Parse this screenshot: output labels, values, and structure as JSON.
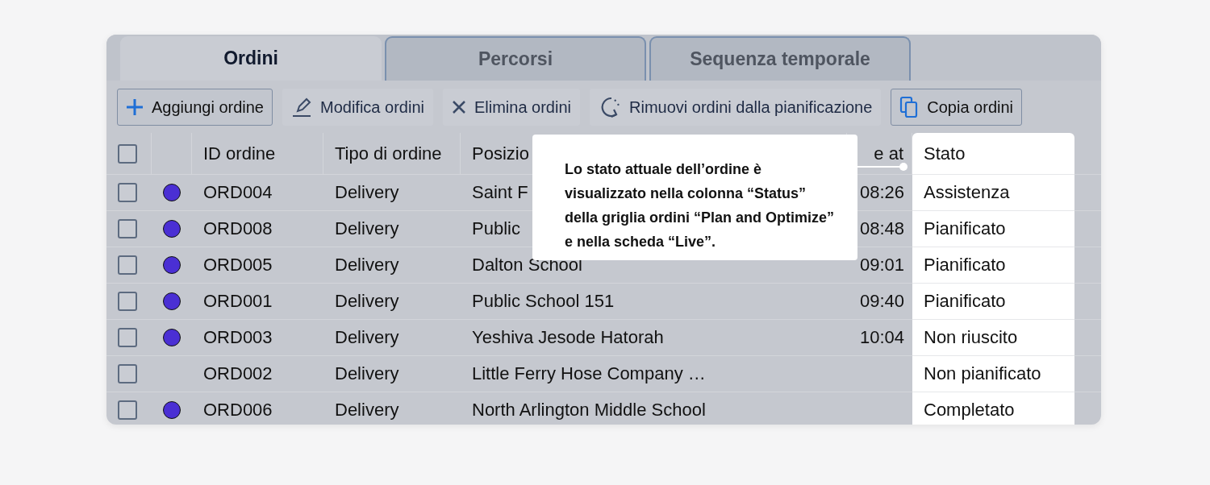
{
  "tabs": [
    {
      "label": "Ordini",
      "selected": true
    },
    {
      "label": "Percorsi",
      "selected": false
    },
    {
      "label": "Sequenza temporale",
      "selected": false
    }
  ],
  "toolbar": [
    {
      "label": "Aggiungi ordine",
      "kind": "add",
      "bordered": true
    },
    {
      "label": "Modifica ordini",
      "kind": "edit",
      "bordered": false
    },
    {
      "label": "Elimina ordini",
      "kind": "delete",
      "bordered": false
    },
    {
      "label": "Rimuovi ordini dalla pianificazione",
      "kind": "unplan",
      "bordered": false
    },
    {
      "label": "Copia ordini",
      "kind": "copy",
      "bordered": true
    }
  ],
  "table": {
    "select_all": {
      "checked": false
    },
    "columns": [
      {
        "label": "ID ordine",
        "highlighted": false
      },
      {
        "label": "Tipo di ordine",
        "highlighted": false
      },
      {
        "label": "Posizio",
        "highlighted": false
      },
      {
        "label": "e at",
        "highlighted": false
      },
      {
        "label": "Stato",
        "highlighted": true
      }
    ],
    "rows": [
      {
        "checked": false,
        "color": "#4a2fd4",
        "id": "ORD004",
        "type": "Delivery",
        "position": "Saint F",
        "column_6": "08:26",
        "status": "Assistenza"
      },
      {
        "checked": false,
        "color": "#4a2fd4",
        "id": "ORD008",
        "type": "Delivery",
        "position": "Public",
        "column_6": "08:48",
        "status": "Pianificato"
      },
      {
        "checked": false,
        "color": "#4a2fd4",
        "id": "ORD005",
        "type": "Delivery",
        "position": "Dalton School",
        "column_6": "09:01",
        "status": "Pianificato"
      },
      {
        "checked": false,
        "color": "#4a2fd4",
        "id": "ORD001",
        "type": "Delivery",
        "position": "Public School 151",
        "column_6": "09:40",
        "status": "Pianificato"
      },
      {
        "checked": false,
        "color": "#4a2fd4",
        "id": "ORD003",
        "type": "Delivery",
        "position": "Yeshiva Jesode Hatorah",
        "column_6": "10:04",
        "status": "Non riuscito"
      },
      {
        "checked": false,
        "id": "ORD002",
        "type": "Delivery",
        "position": "Little Ferry Hose Company …",
        "status": "Non pianificato"
      },
      {
        "checked": false,
        "color": "#4a2fd4",
        "id": "ORD006",
        "type": "Delivery",
        "position": "North Arlington Middle School",
        "status": "Completato"
      }
    ]
  },
  "callout": {
    "text": "Lo stato attuale dell’ordine è visualizzato nella colonna “Status” della griglia ordini “Plan and Optimize” e nella scheda “Live”."
  }
}
